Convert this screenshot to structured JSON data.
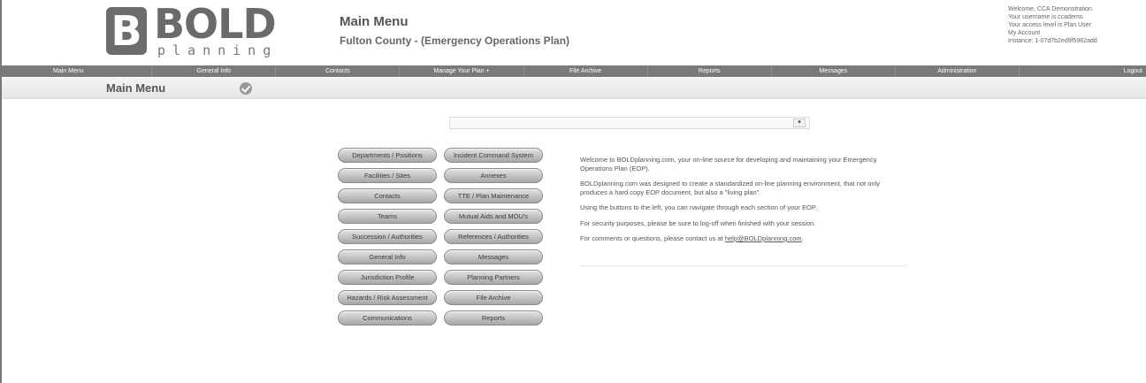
{
  "logo": {
    "word": "BOLD",
    "sub": "planning",
    "mark": "B"
  },
  "header": {
    "title": "Main Menu",
    "subtitle": "Fulton County - (Emergency Operations Plan)",
    "welcome": [
      "Welcome, CCA Demonstration.",
      "Your username is ccademo.",
      "Your access level is Plan User",
      "My Account",
      "Instance: 1-07d7b2ed9f5962add"
    ]
  },
  "nav": [
    "Main Menu",
    "General Info",
    "Contacts",
    "Manage Your Plan +",
    "File Archive",
    "Reports",
    "Messages",
    "Administration",
    "Logout"
  ],
  "subbar": {
    "title": "Main Menu"
  },
  "select": {
    "arrow": "▾"
  },
  "buttons": [
    "Departments / Positions",
    "Incident Command System",
    "Facilities / Sites",
    "Annexes",
    "Contacts",
    "TTE / Plan Maintenance",
    "Teams",
    "Mutual Aids and MOU's",
    "Succession / Authorities",
    "References / Authorities",
    "General Info",
    "Messages",
    "Jurisdiction Profile",
    "Planning Partners",
    "Hazards / Risk Assessment",
    "File Archive",
    "Communications",
    "Reports"
  ],
  "intro": {
    "p1": "Welcome to BOLDplanning.com, your on-line source for developing and maintaining your Emergency Operations Plan (EOP).",
    "p2": "BOLDplanning.com was designed to create a standardized on-line planning environment, that not only produces a hard copy EOP document, but also a \"living plan\".",
    "p3": "Using the buttons to the left, you can navigate through each section of your EOP.",
    "p4": "For security purposes, please be sure to log-off when finished with your session.",
    "p5_prefix": "For comments or questions, please contact us at ",
    "p5_link": "help@BOLDplanning.com",
    "p5_suffix": "."
  }
}
